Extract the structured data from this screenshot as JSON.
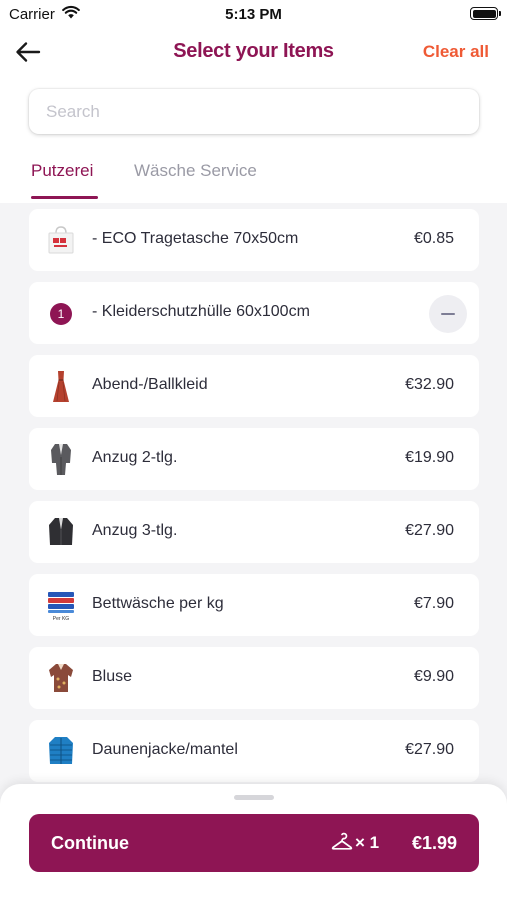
{
  "status_bar": {
    "carrier": "Carrier",
    "time": "5:13 PM"
  },
  "header": {
    "title": "Select your Items",
    "clear_label": "Clear all",
    "back_icon": "arrow-left-icon"
  },
  "search": {
    "placeholder": "Search",
    "value": ""
  },
  "tabs": [
    {
      "label": "Putzerei",
      "active": true
    },
    {
      "label": "Wäsche Service",
      "active": false
    }
  ],
  "items": [
    {
      "name": "- ECO Tragetasche 70x50cm",
      "price": "€0.85",
      "icon": "bag-icon"
    },
    {
      "name": "- Kleiderschutzhülle 60x100cm",
      "price": "",
      "quantity": "1",
      "icon": "quantity-badge"
    },
    {
      "name": "Abend-/Ballkleid",
      "price": "€32.90",
      "icon": "dress-icon"
    },
    {
      "name": "Anzug 2-tlg.",
      "price": "€19.90",
      "icon": "suit-icon"
    },
    {
      "name": "Anzug 3-tlg.",
      "price": "€27.90",
      "icon": "jacket-icon"
    },
    {
      "name": "Bettwäsche per kg",
      "price": "€7.90",
      "icon": "bed-linen-icon",
      "icon_caption": "Per KG"
    },
    {
      "name": "Bluse",
      "price": "€9.90",
      "icon": "blouse-icon"
    },
    {
      "name": "Daunenjacke/mantel",
      "price": "€27.90",
      "icon": "down-jacket-icon"
    }
  ],
  "footer": {
    "continue_label": "Continue",
    "count": "× 1",
    "total": "€1.99",
    "hanger_icon": "hanger-icon"
  },
  "colors": {
    "brand": "#8e1554",
    "accent": "#ef5a35",
    "background": "#f4f4f6"
  }
}
